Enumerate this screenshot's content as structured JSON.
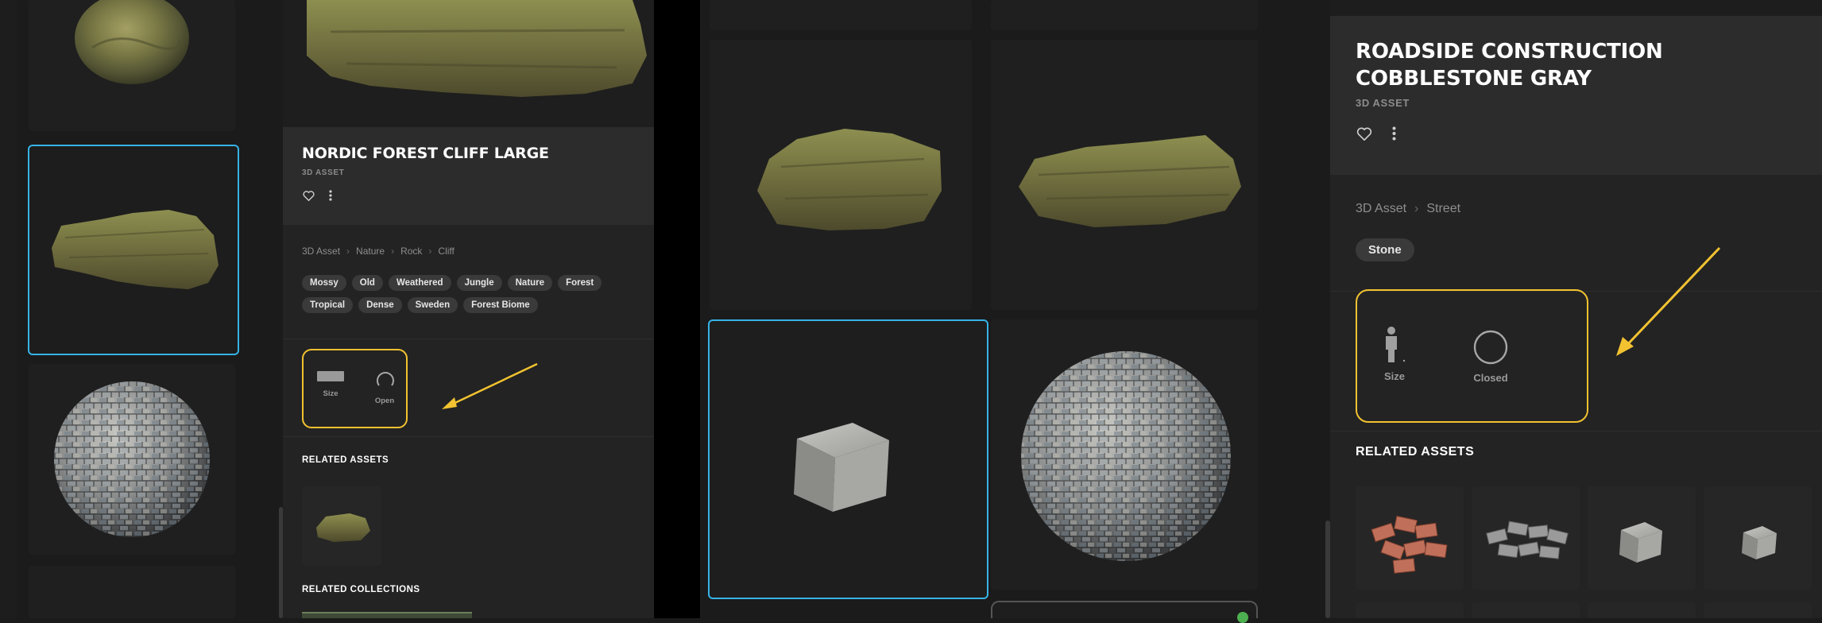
{
  "left_panel": {
    "asset": {
      "title": "NORDIC FOREST CLIFF LARGE",
      "type": "3D ASSET"
    },
    "breadcrumb": [
      "3D Asset",
      "Nature",
      "Rock",
      "Cliff"
    ],
    "tags": [
      "Mossy",
      "Old",
      "Weathered",
      "Jungle",
      "Nature",
      "Forest",
      "Tropical",
      "Dense",
      "Sweden",
      "Forest Biome"
    ],
    "metrics": {
      "size_label": "Size",
      "state_label": "Open"
    },
    "related_assets_heading": "RELATED ASSETS",
    "related_collections_heading": "RELATED COLLECTIONS"
  },
  "right_panel": {
    "asset": {
      "title": "ROADSIDE CONSTRUCTION COBBLESTONE GRAY",
      "type": "3D ASSET"
    },
    "breadcrumb": [
      "3D Asset",
      "Street"
    ],
    "tags": [
      "Stone"
    ],
    "metrics": {
      "size_label": "Size",
      "state_label": "Closed"
    },
    "related_assets_heading": "RELATED ASSETS"
  },
  "colors": {
    "selection": "#36b3e6",
    "highlight": "#f2c230",
    "panel": "#2c2c2c",
    "background": "#1b1b1b"
  },
  "icons": [
    "heart-icon",
    "more-vertical-icon",
    "chevron-right-icon",
    "ruler-bar-icon",
    "open-circle-icon",
    "person-icon",
    "closed-circle-icon",
    "arrow-annotation"
  ]
}
